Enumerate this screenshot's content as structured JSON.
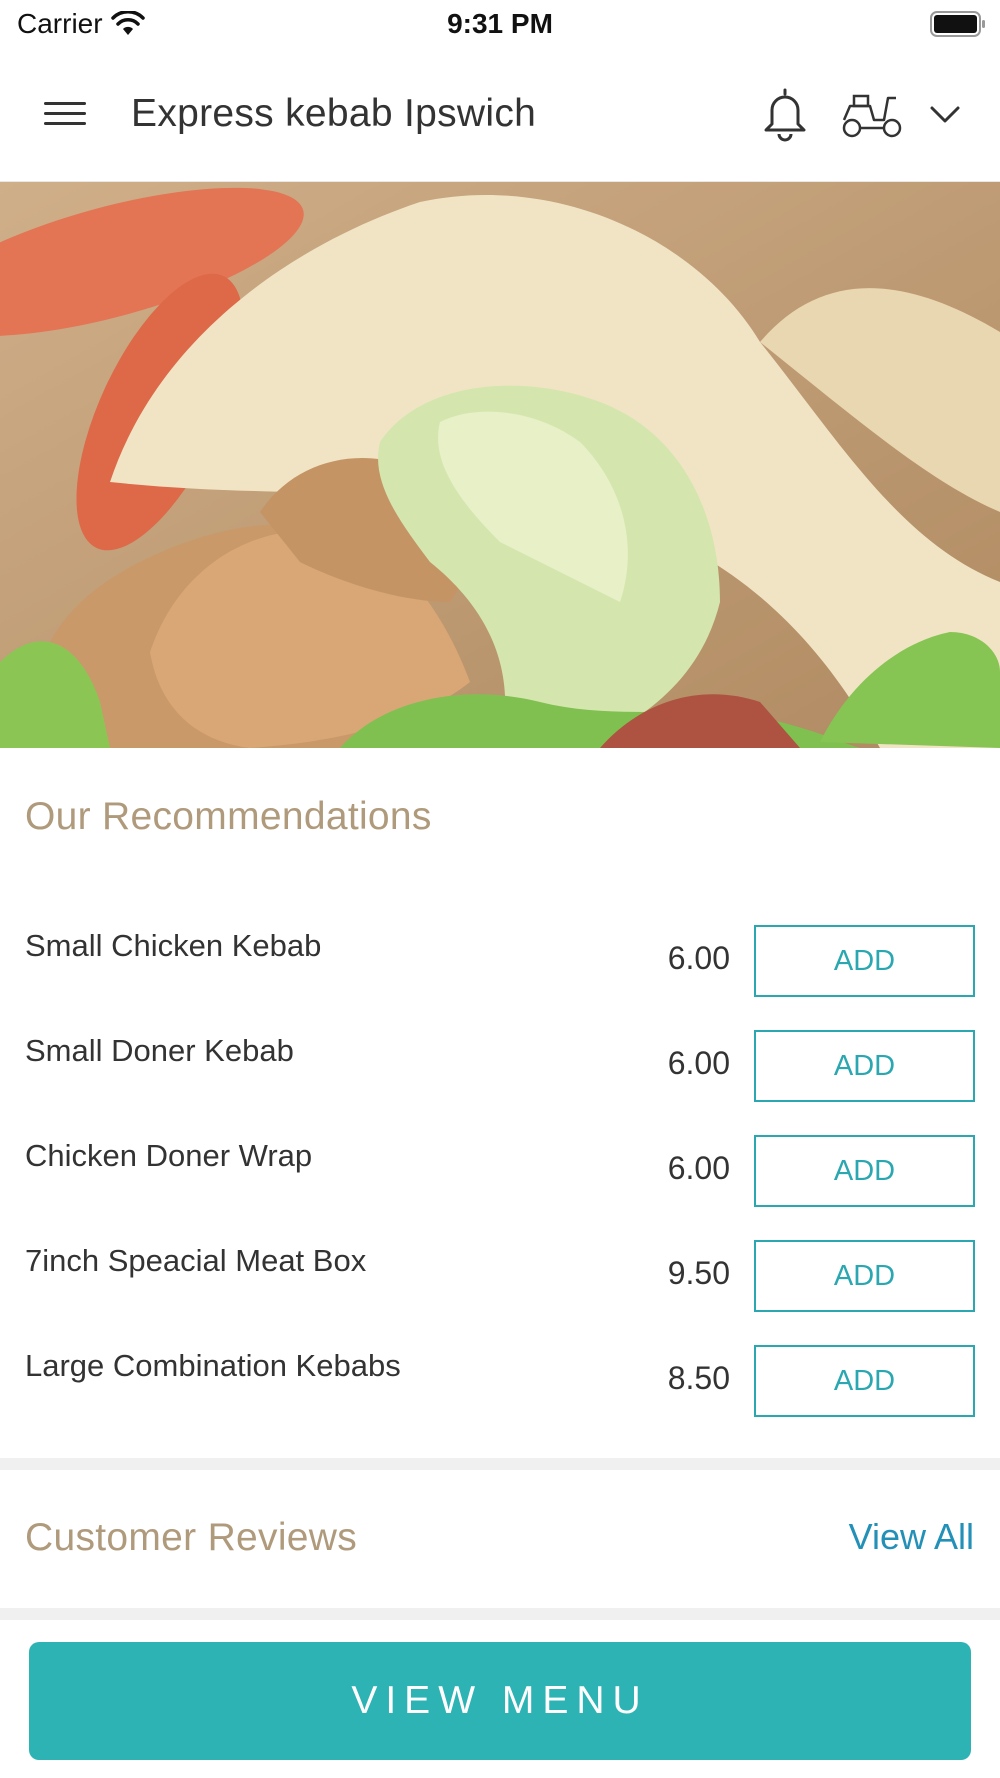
{
  "status_bar": {
    "carrier": "Carrier",
    "time": "9:31 PM",
    "icons": [
      "wifi-icon",
      "battery-icon"
    ]
  },
  "header": {
    "title": "Express kebab Ipswich",
    "icons": [
      "menu-icon",
      "bell-icon",
      "scooter-icon",
      "chevron-down-icon"
    ]
  },
  "hero": {
    "image": "kebab wrap photo"
  },
  "recommendations": {
    "title": "Our Recommendations",
    "items": [
      {
        "name": "Small Chicken Kebab",
        "price": "6.00",
        "action": "ADD"
      },
      {
        "name": "Small Doner Kebab",
        "price": "6.00",
        "action": "ADD"
      },
      {
        "name": "Chicken Doner Wrap",
        "price": "6.00",
        "action": "ADD"
      },
      {
        "name": "7inch Speacial Meat Box",
        "price": "9.50",
        "action": "ADD"
      },
      {
        "name": "Large Combination Kebabs",
        "price": "8.50",
        "action": "ADD"
      }
    ]
  },
  "reviews": {
    "title": "Customer Reviews",
    "view_all": "View All"
  },
  "footer": {
    "button": "VIEW MENU"
  },
  "colors": {
    "accent": "#2eb3b4",
    "section_title": "#b09a7c",
    "link": "#2390b8",
    "add_border": "#2aa7b0"
  }
}
